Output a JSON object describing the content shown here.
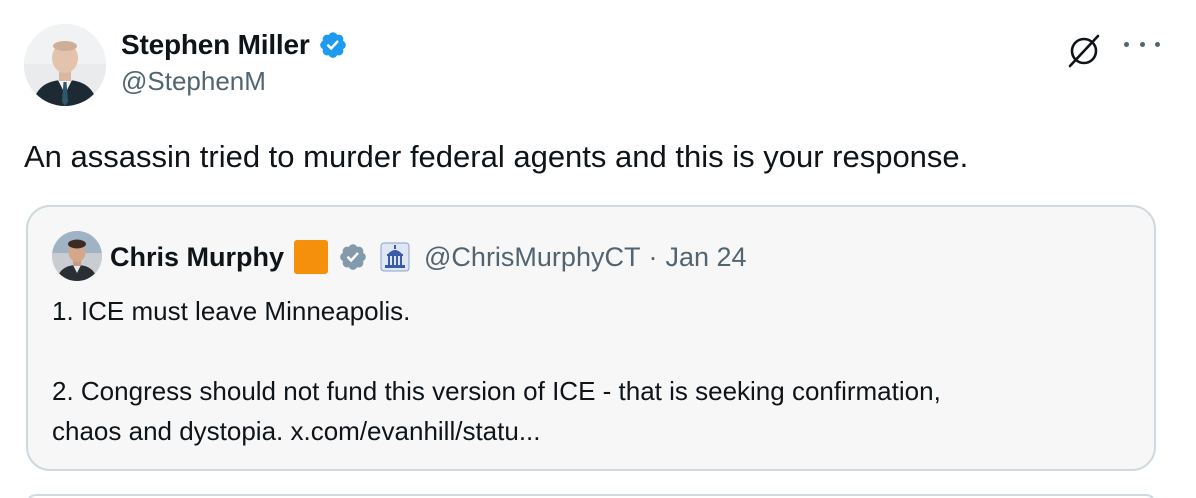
{
  "post": {
    "author": {
      "display_name": "Stephen Miller",
      "handle": "@StephenM",
      "verified": true,
      "verified_color": "#1d9bf0"
    },
    "text": "An assassin tried to murder federal agents and this is your response.",
    "actions": {
      "grok_icon": "grok-icon",
      "more_icon": "more-options-icon"
    }
  },
  "quoted_post": {
    "author": {
      "display_name": "Chris Murphy",
      "handle": "@ChrisMurphyCT",
      "separator": "·",
      "date": "Jan 24",
      "verified": true,
      "verified_color": "#829aab",
      "badges": [
        "orange-square-emoji",
        "government-building-icon"
      ]
    },
    "lines": [
      "1. ICE must leave Minneapolis.",
      "2. Congress should not fund this version of ICE - that is seeking confirmation,",
      "chaos and dystopia. x.com/evanhill/statu..."
    ]
  }
}
